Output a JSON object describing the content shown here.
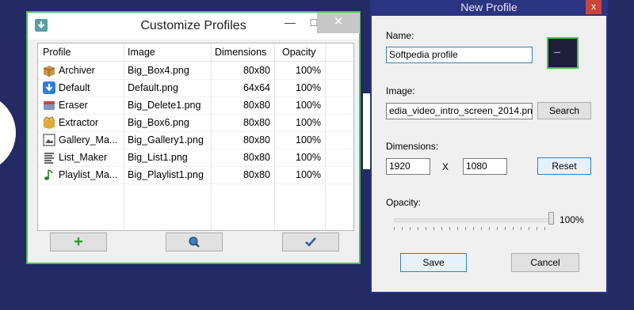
{
  "customize": {
    "title": "Customize Profiles",
    "columns": [
      "Profile",
      "Image",
      "Dimensions",
      "Opacity"
    ],
    "rows": [
      {
        "name": "Archiver",
        "image": "Big_Box4.png",
        "dims": "80x80",
        "opacity": "100%",
        "icon": "box-icon"
      },
      {
        "name": "Default",
        "image": "Default.png",
        "dims": "64x64",
        "opacity": "100%",
        "icon": "download-arrow-icon"
      },
      {
        "name": "Eraser",
        "image": "Big_Delete1.png",
        "dims": "80x80",
        "opacity": "100%",
        "icon": "eraser-icon"
      },
      {
        "name": "Extractor",
        "image": "Big_Box6.png",
        "dims": "80x80",
        "opacity": "100%",
        "icon": "open-box-icon"
      },
      {
        "name": "Gallery_Ma...",
        "image": "Big_Gallery1.png",
        "dims": "80x80",
        "opacity": "100%",
        "icon": "gallery-icon"
      },
      {
        "name": "List_Maker",
        "image": "Big_List1.png",
        "dims": "80x80",
        "opacity": "100%",
        "icon": "list-icon"
      },
      {
        "name": "Playlist_Ma...",
        "image": "Big_Playlist1.png",
        "dims": "80x80",
        "opacity": "100%",
        "icon": "music-note-icon"
      }
    ],
    "buttons": {
      "add": "+",
      "search": "magnifier-icon",
      "ok": "checkmark-icon"
    },
    "controls": {
      "minimize": "—",
      "maximize": "□",
      "close": "✕"
    }
  },
  "new_profile": {
    "title": "New Profile",
    "close": "x",
    "name_label": "Name:",
    "name_value": "Softpedia profile",
    "image_label": "Image:",
    "image_value": "edia_video_intro_screen_2014.png",
    "search_button": "Search",
    "dimensions_label": "Dimensions:",
    "width_value": "1920",
    "x_label": "X",
    "height_value": "1080",
    "reset_button": "Reset",
    "opacity_label": "Opacity:",
    "opacity_value": "100%",
    "opacity_level": 1.0,
    "save_button": "Save",
    "cancel_button": "Cancel"
  },
  "colors": {
    "accent_green": "#4cbe56",
    "desktop_bg": "#232a64",
    "dialog_titlebar": "#2a3480"
  }
}
